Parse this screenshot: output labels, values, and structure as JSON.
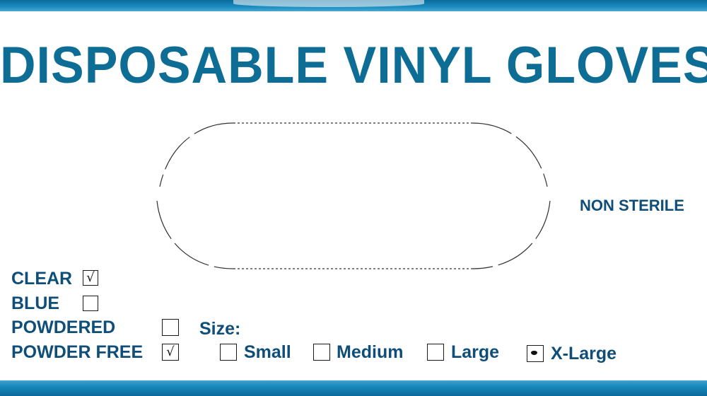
{
  "title": "DISPOSABLE VINYL GLOVES",
  "non_sterile": "NON STERILE",
  "options": {
    "clear": {
      "label": "CLEAR",
      "mark": "√"
    },
    "blue": {
      "label": "BLUE",
      "mark": ""
    },
    "powdered": {
      "label": "POWDERED",
      "mark": ""
    },
    "powder_free": {
      "label": "POWDER FREE",
      "mark": "√"
    }
  },
  "size": {
    "label": "Size:",
    "small": {
      "label": "Small",
      "mark": ""
    },
    "medium": {
      "label": "Medium",
      "mark": ""
    },
    "large": {
      "label": "Large",
      "mark": ""
    },
    "x_large": {
      "label": "X-Large",
      "mark": ""
    }
  },
  "colors": {
    "band": "#1787bb",
    "title": "#0d6d95",
    "text": "#0f4e78"
  }
}
